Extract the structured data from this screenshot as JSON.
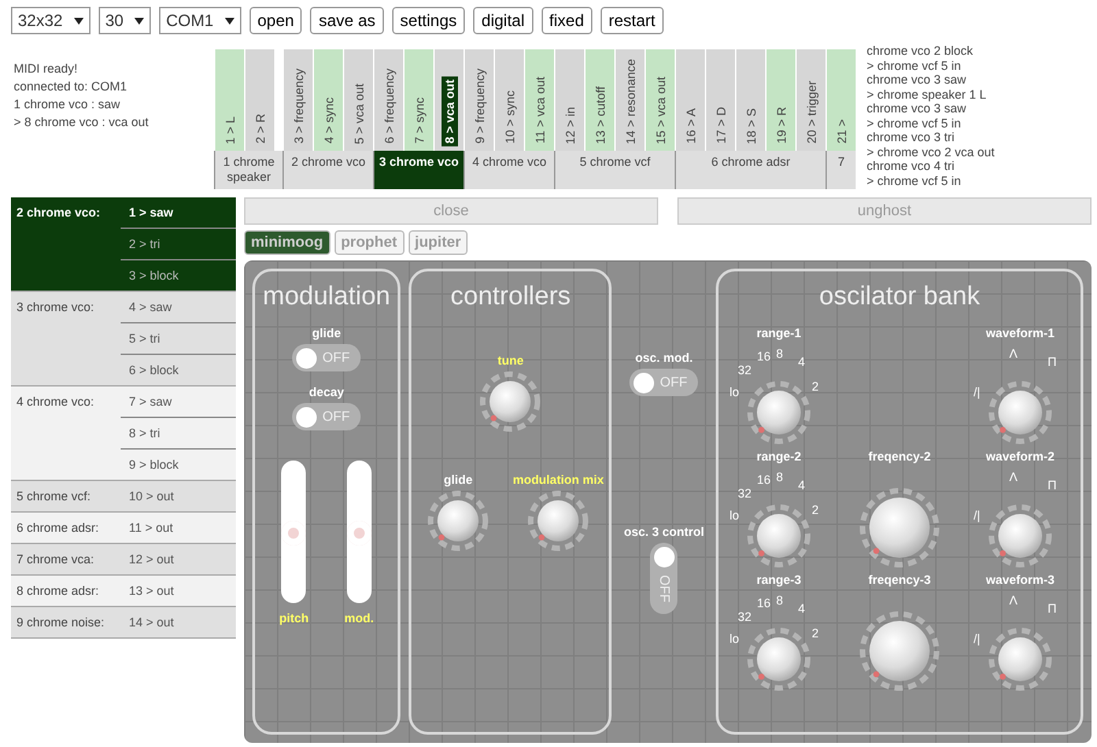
{
  "toolbar": {
    "selects": [
      "32x32",
      "30",
      "COM1"
    ],
    "buttons": [
      "open",
      "save as",
      "settings",
      "digital",
      "fixed",
      "restart"
    ]
  },
  "log": [
    "MIDI ready!",
    "connected to: COM1",
    "1 chrome vco : saw",
    "> 8 chrome vco : vca out"
  ],
  "patch": {
    "devices": [
      {
        "label": "1 chrome speaker",
        "selected": false,
        "inputs": [
          {
            "label": "1 > L",
            "connected": true,
            "selected": false
          },
          {
            "label": "2 > R",
            "connected": false,
            "selected": false
          }
        ]
      },
      {
        "label": "2 chrome vco",
        "selected": false,
        "inputs": [
          {
            "label": "3 > frequency",
            "connected": false,
            "selected": false
          },
          {
            "label": "4 > sync",
            "connected": true,
            "selected": false
          },
          {
            "label": "5 > vca out",
            "connected": false,
            "selected": false
          }
        ]
      },
      {
        "label": "3 chrome vco",
        "selected": true,
        "inputs": [
          {
            "label": "6 > frequency",
            "connected": false,
            "selected": false
          },
          {
            "label": "7 > sync",
            "connected": true,
            "selected": false
          },
          {
            "label": "8 > vca out",
            "connected": false,
            "selected": true
          }
        ]
      },
      {
        "label": "4 chrome vco",
        "selected": false,
        "inputs": [
          {
            "label": "9 > frequency",
            "connected": false,
            "selected": false
          },
          {
            "label": "10 > sync",
            "connected": false,
            "selected": false
          },
          {
            "label": "11 > vca out",
            "connected": true,
            "selected": false
          }
        ]
      },
      {
        "label": "5 chrome vcf",
        "selected": false,
        "inputs": [
          {
            "label": "12 > in",
            "connected": false,
            "selected": false
          },
          {
            "label": "13 > cutoff",
            "connected": true,
            "selected": false
          },
          {
            "label": "14 > resonance",
            "connected": false,
            "selected": false
          },
          {
            "label": "15 > vca out",
            "connected": true,
            "selected": false
          }
        ]
      },
      {
        "label": "6 chrome adsr",
        "selected": false,
        "inputs": [
          {
            "label": "16 > A",
            "connected": false,
            "selected": false
          },
          {
            "label": "17 > D",
            "connected": false,
            "selected": false
          },
          {
            "label": "18 > S",
            "connected": false,
            "selected": false
          },
          {
            "label": "19 > R",
            "connected": true,
            "selected": false
          },
          {
            "label": "20 > trigger",
            "connected": false,
            "selected": false
          }
        ]
      },
      {
        "label": "7",
        "selected": false,
        "inputs": [
          {
            "label": "21 >",
            "connected": true,
            "selected": false
          }
        ]
      }
    ]
  },
  "connections": [
    "chrome vco 2 block",
    "> chrome vcf 5 in",
    "chrome vco 3 saw",
    "> chrome speaker 1 L",
    "chrome vco 3 saw",
    "> chrome vcf 5 in",
    "chrome vco 3 tri",
    "> chrome vco 2 vca out",
    "chrome vco 4 tri",
    "> chrome vcf 5 in"
  ],
  "outputs": [
    {
      "device": "2 chrome vco:",
      "selected": true,
      "outputs": [
        {
          "label": "1 > saw",
          "selected": true
        },
        {
          "label": "2 > tri",
          "selected": false
        },
        {
          "label": "3 > block",
          "selected": false
        }
      ]
    },
    {
      "device": "3 chrome vco:",
      "selected": false,
      "outputs": [
        {
          "label": "4 > saw",
          "selected": false
        },
        {
          "label": "5 > tri",
          "selected": false
        },
        {
          "label": "6 > block",
          "selected": false
        }
      ]
    },
    {
      "device": "4 chrome vco:",
      "selected": false,
      "outputs": [
        {
          "label": "7 > saw",
          "selected": false
        },
        {
          "label": "8 > tri",
          "selected": false
        },
        {
          "label": "9 > block",
          "selected": false
        }
      ]
    },
    {
      "device": "5 chrome vcf:",
      "selected": false,
      "outputs": [
        {
          "label": "10 > out",
          "selected": false
        }
      ]
    },
    {
      "device": "6 chrome adsr:",
      "selected": false,
      "outputs": [
        {
          "label": "11 > out",
          "selected": false
        }
      ]
    },
    {
      "device": "7 chrome vca:",
      "selected": false,
      "outputs": [
        {
          "label": "12 > out",
          "selected": false
        }
      ]
    },
    {
      "device": "8 chrome adsr:",
      "selected": false,
      "outputs": [
        {
          "label": "13 > out",
          "selected": false
        }
      ]
    },
    {
      "device": "9 chrome noise:",
      "selected": false,
      "outputs": [
        {
          "label": "14 > out",
          "selected": false
        }
      ]
    }
  ],
  "overlay": {
    "close": "close",
    "unghost": "unghost",
    "presets": [
      {
        "label": "minimoog",
        "selected": true
      },
      {
        "label": "prophet",
        "selected": false
      },
      {
        "label": "jupiter",
        "selected": false
      }
    ]
  },
  "synth": {
    "modulation": {
      "title": "modulation",
      "toggles": [
        {
          "label": "glide",
          "text": "OFF",
          "on": false
        },
        {
          "label": "decay",
          "text": "OFF",
          "on": false
        }
      ],
      "sliders": [
        {
          "label": "pitch",
          "level": 0.5
        },
        {
          "label": "mod.",
          "level": 0.5
        }
      ]
    },
    "controllers": {
      "title": "controllers",
      "knobs": [
        {
          "label": "tune",
          "highlighted": true
        },
        {
          "label": "glide",
          "highlighted": false
        },
        {
          "label": "modulation mix",
          "highlighted": true
        }
      ],
      "toggle": {
        "label": "osc. mod.",
        "text": "OFF",
        "on": false
      }
    },
    "osc3_control": {
      "label": "osc. 3 control",
      "text": "OFF",
      "on": false
    },
    "oscillator_bank": {
      "title": "oscilator bank",
      "rows": [
        {
          "knobs": [
            {
              "kind": "range",
              "label": "range-1",
              "marks": [
                "lo",
                "32",
                "16",
                "8",
                "4",
                "2"
              ]
            },
            {
              "kind": "waveform",
              "label": "waveform-1",
              "marks": [
                "/|",
                "Λ",
                "Π"
              ]
            }
          ]
        },
        {
          "knobs": [
            {
              "kind": "range",
              "label": "range-2",
              "marks": [
                "lo",
                "32",
                "16",
                "8",
                "4",
                "2"
              ]
            },
            {
              "kind": "frequency",
              "label": "freqency-2"
            },
            {
              "kind": "waveform",
              "label": "waveform-2",
              "marks": [
                "/|",
                "Λ",
                "Π"
              ]
            }
          ]
        },
        {
          "knobs": [
            {
              "kind": "range",
              "label": "range-3",
              "marks": [
                "lo",
                "32",
                "16",
                "8",
                "4",
                "2"
              ]
            },
            {
              "kind": "frequency",
              "label": "freqency-3"
            },
            {
              "kind": "waveform",
              "label": "waveform-3",
              "marks": [
                "/|",
                "Λ",
                "Π"
              ]
            }
          ]
        }
      ]
    }
  }
}
